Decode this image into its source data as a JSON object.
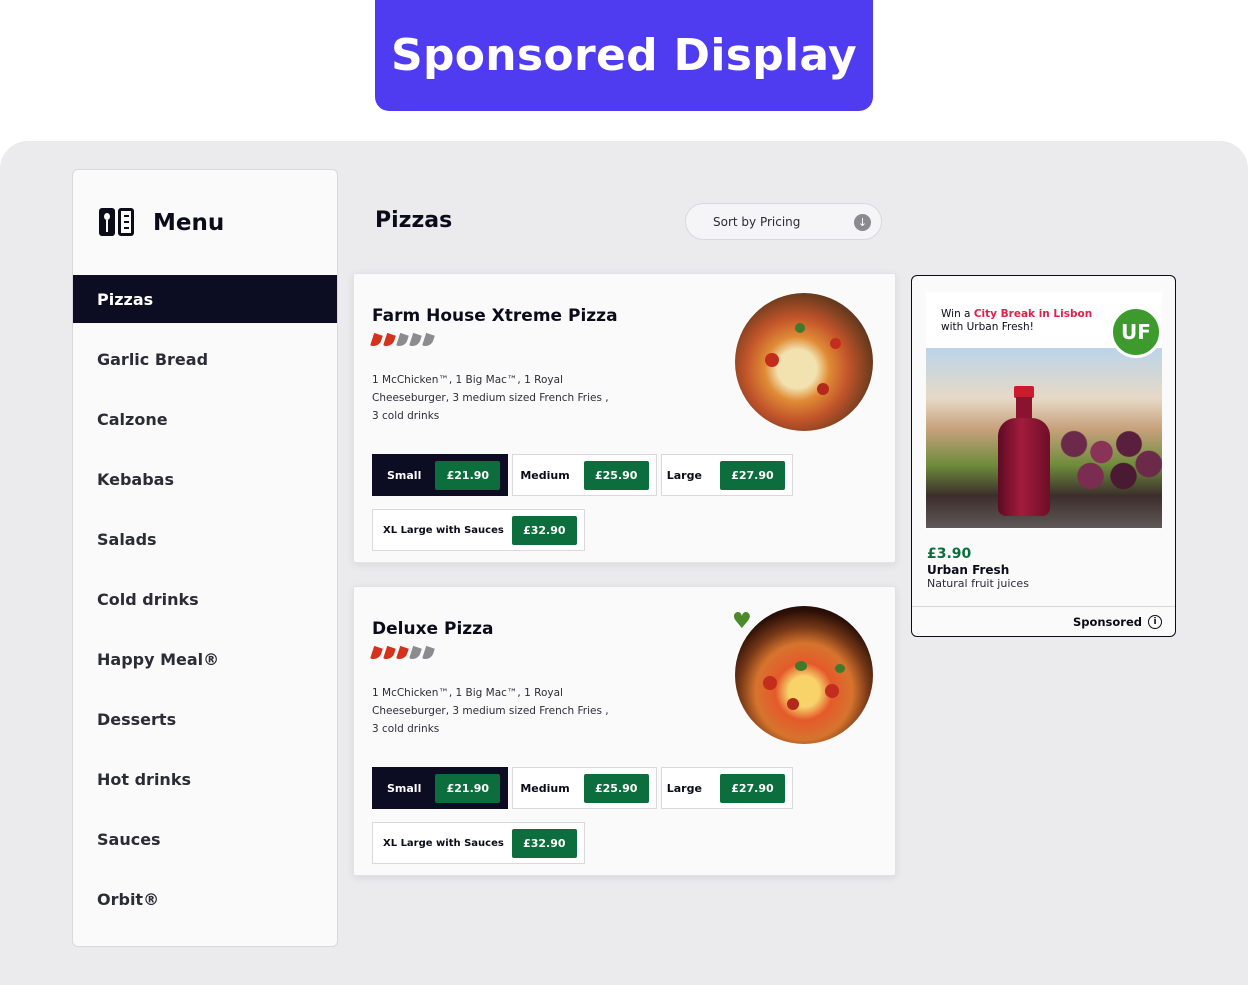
{
  "banner": {
    "title": "Sponsored Display"
  },
  "sidebar": {
    "title": "Menu",
    "icon": "menu-book-icon",
    "items": [
      {
        "label": "Pizzas",
        "active": true
      },
      {
        "label": "Garlic Bread"
      },
      {
        "label": "Calzone"
      },
      {
        "label": "Kebabas"
      },
      {
        "label": "Salads"
      },
      {
        "label": "Cold drinks"
      },
      {
        "label": "Happy Meal®"
      },
      {
        "label": "Desserts"
      },
      {
        "label": "Hot drinks"
      },
      {
        "label": "Sauces"
      },
      {
        "label": "Orbit®"
      }
    ]
  },
  "header": {
    "title": "Pizzas",
    "sort_label": "Sort by Pricing",
    "sort_icon": "arrow-down-icon"
  },
  "products": [
    {
      "name": "Farm House Xtreme Pizza",
      "spice_level": 2,
      "spice_max": 5,
      "desc_lines": [
        "1 McChicken™, 1 Big Mac™,  1 Royal",
        "Cheeseburger, 3 medium sized French Fries ,",
        "3 cold drinks"
      ],
      "sizes": [
        {
          "label": "Small",
          "price": "£21.90",
          "selected": true
        },
        {
          "label": "Medium",
          "price": "£25.90"
        },
        {
          "label": "Large",
          "price": "£27.90"
        },
        {
          "label": "XL Large with Sauces",
          "price": "£32.90"
        }
      ]
    },
    {
      "name": "Deluxe Pizza",
      "spice_level": 3,
      "spice_max": 5,
      "desc_lines": [
        "1 McChicken™, 1 Big Mac™,  1 Royal",
        "Cheeseburger, 3 medium sized French Fries ,",
        "3 cold drinks"
      ],
      "sizes": [
        {
          "label": "Small",
          "price": "£21.90",
          "selected": true
        },
        {
          "label": "Medium",
          "price": "£25.90"
        },
        {
          "label": "Large",
          "price": "£27.90"
        },
        {
          "label": "XL Large with Sauces",
          "price": "£32.90"
        }
      ]
    }
  ],
  "ad": {
    "headline_prefix": "Win a ",
    "headline_highlight": "City Break in Lisbon",
    "headline_line2": "with Urban Fresh!",
    "price": "£3.90",
    "brand": "Urban Fresh",
    "subtitle": "Natural fruit juices",
    "sponsored_label": "Sponsored",
    "info_icon": "info-icon"
  },
  "colors": {
    "banner": "#4f3bf0",
    "active_nav": "#0c0c22",
    "price_green": "#0b6e3c",
    "ad_highlight": "#e01f4a"
  }
}
